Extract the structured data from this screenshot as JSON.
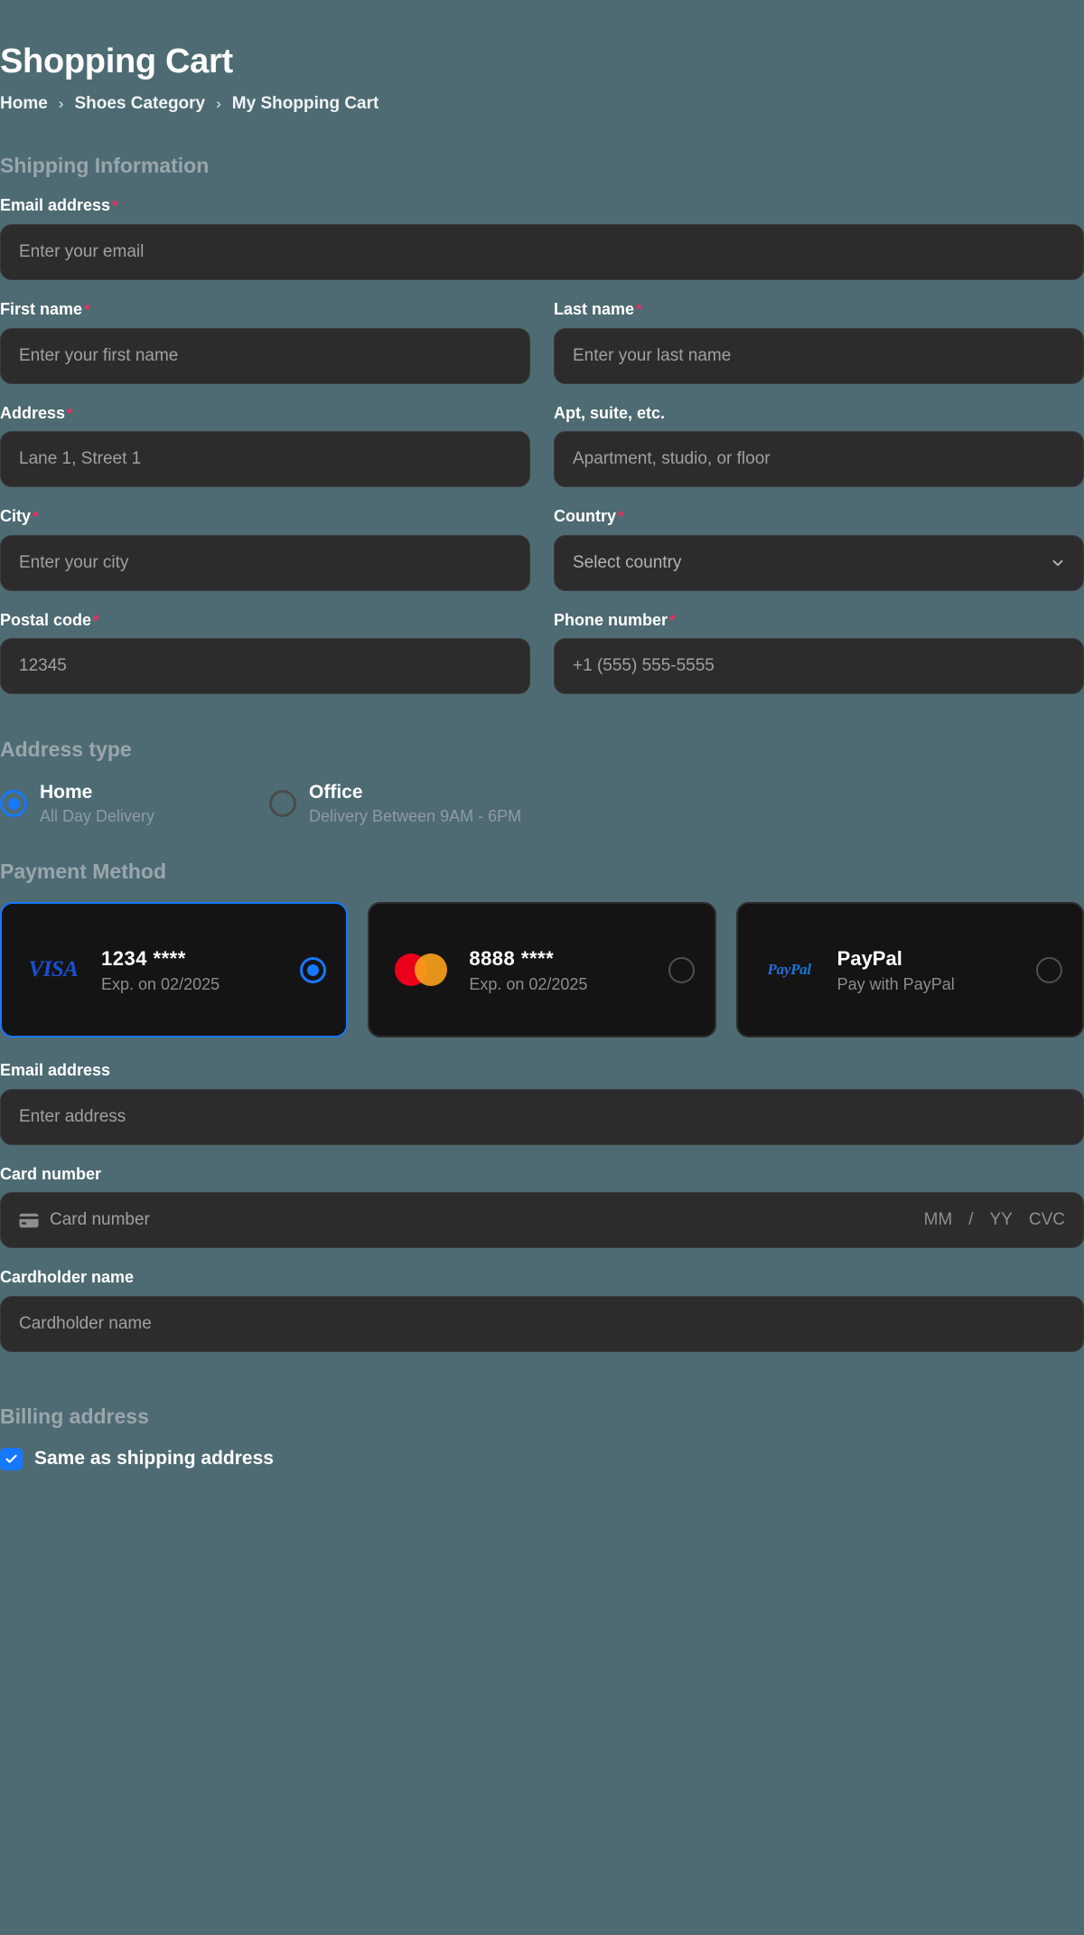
{
  "header": {
    "title": "Shopping Cart",
    "breadcrumb": [
      {
        "label": "Home"
      },
      {
        "label": "Shoes Category"
      },
      {
        "label": "My Shopping Cart"
      }
    ],
    "separator": "›"
  },
  "shipping": {
    "heading": "Shipping Information",
    "email": {
      "label": "Email address",
      "required": "*",
      "placeholder": "Enter your email",
      "value": ""
    },
    "first_name": {
      "label": "First name",
      "required": "*",
      "placeholder": "Enter your first name",
      "value": ""
    },
    "last_name": {
      "label": "Last name",
      "required": "*",
      "placeholder": "Enter your last name",
      "value": ""
    },
    "address": {
      "label": "Address",
      "required": "*",
      "placeholder": "Lane 1, Street 1",
      "value": ""
    },
    "apt": {
      "label": "Apt, suite, etc.",
      "required": "",
      "placeholder": "Apartment, studio, or floor",
      "value": ""
    },
    "city": {
      "label": "City",
      "required": "*",
      "placeholder": "Enter your city",
      "value": ""
    },
    "country": {
      "label": "Country",
      "required": "*",
      "placeholder": "Select country",
      "selected": "Select country"
    },
    "postal_code": {
      "label": "Postal code",
      "required": "*",
      "placeholder": "12345",
      "value": ""
    },
    "phone": {
      "label": "Phone number",
      "required": "*",
      "placeholder": "+1 (555) 555-5555",
      "value": ""
    }
  },
  "address_type": {
    "heading": "Address type",
    "options": [
      {
        "title": "Home",
        "subtitle": "All Day Delivery",
        "selected": true
      },
      {
        "title": "Office",
        "subtitle": "Delivery Between 9AM - 6PM",
        "selected": false
      }
    ]
  },
  "payment": {
    "heading": "Payment Method",
    "cards": [
      {
        "brand": "visa",
        "logo_text": "VISA",
        "title": "1234 ****",
        "subtitle": "Exp. on 02/2025",
        "selected": true
      },
      {
        "brand": "mastercard",
        "logo_text": "",
        "title": "8888 ****",
        "subtitle": "Exp. on 02/2025",
        "selected": false
      },
      {
        "brand": "paypal",
        "logo_text": "PayPal",
        "title": "PayPal",
        "subtitle": "Pay with PayPal",
        "selected": false
      }
    ],
    "email": {
      "label": "Email address",
      "placeholder": "Enter address",
      "value": ""
    },
    "card_number": {
      "label": "Card number",
      "placeholder": "Card number",
      "value": "",
      "mm_placeholder": "MM",
      "slash": "/",
      "yy_placeholder": "YY",
      "cvc_placeholder": "CVC"
    },
    "cardholder": {
      "label": "Cardholder name",
      "placeholder": "Cardholder name",
      "value": ""
    }
  },
  "billing": {
    "heading": "Billing address",
    "same_as_shipping": {
      "label": "Same as shipping address",
      "checked": true
    }
  },
  "colors": {
    "background": "#4e6b73",
    "input_bg": "#2c2c2c",
    "card_bg": "#141414",
    "accent": "#1677ff",
    "required": "#ec2e63",
    "muted_heading": "#9aa6ab",
    "placeholder": "#a0a0a0"
  }
}
